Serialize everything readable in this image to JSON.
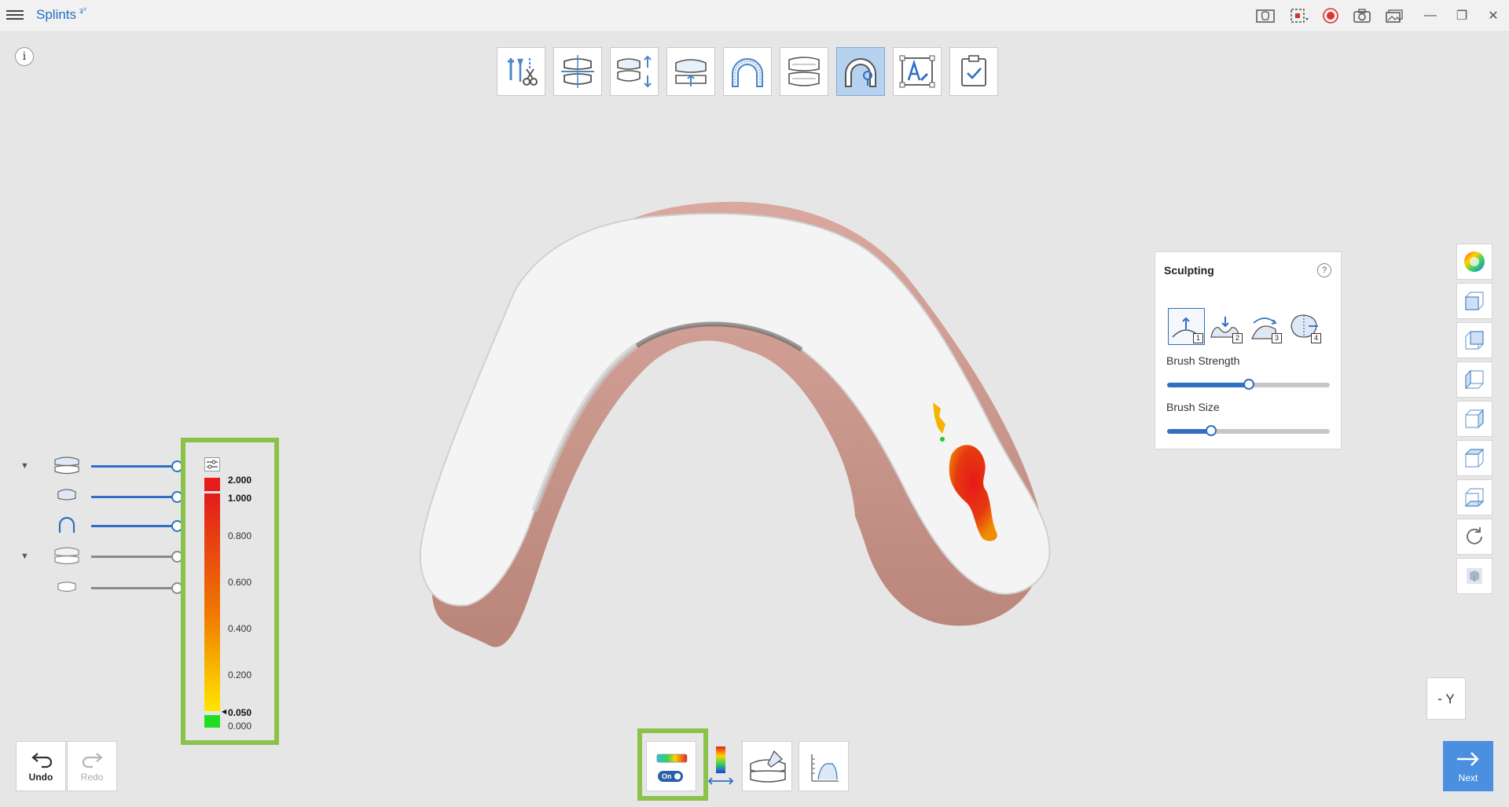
{
  "app": {
    "title": "Splints",
    "title_badge": "ⱻⱽ"
  },
  "window": {
    "minimize": "—",
    "maximize": "❐",
    "close": "✕"
  },
  "info_icon": "i",
  "workflow_steps": [
    {
      "name": "tooth-prep"
    },
    {
      "name": "bite-align"
    },
    {
      "name": "insertion-direction"
    },
    {
      "name": "occlusal-plane"
    },
    {
      "name": "design-arch"
    },
    {
      "name": "occlusion-check"
    },
    {
      "name": "sculpting",
      "active": true
    },
    {
      "name": "text-label"
    },
    {
      "name": "finish"
    }
  ],
  "layers": [
    {
      "name": "upper-jaw-with-splint",
      "expandable": true,
      "visible": true
    },
    {
      "name": "upper-splint",
      "expandable": false,
      "visible": true
    },
    {
      "name": "splint-shell",
      "expandable": false,
      "visible": true
    },
    {
      "name": "lower-jaw",
      "expandable": true,
      "visible": false
    },
    {
      "name": "lower-antagonist",
      "expandable": false,
      "visible": false
    }
  ],
  "deviation_legend": {
    "labels": [
      "2.000",
      "1.000",
      "0.800",
      "0.600",
      "0.400",
      "0.200",
      "0.050",
      "0.000"
    ],
    "bold_labels": [
      "2.000",
      "1.000",
      "0.050"
    ],
    "colors": {
      "top": "#e02424",
      "mid": "#f08c00",
      "low": "#ffe000",
      "zero": "#22dd22"
    }
  },
  "sculpting": {
    "title": "Sculpting",
    "help_icon": "?",
    "tools": [
      {
        "name": "add-brush",
        "number": "1",
        "active": true
      },
      {
        "name": "remove-brush",
        "number": "2"
      },
      {
        "name": "smooth-brush",
        "number": "3"
      },
      {
        "name": "morph-brush",
        "number": "4"
      }
    ],
    "brush_strength_label": "Brush Strength",
    "brush_strength": 0.5,
    "brush_size_label": "Brush Size",
    "brush_size": 0.27
  },
  "view_controls": [
    "color-wheel",
    "view-front",
    "view-back",
    "view-left",
    "view-right",
    "view-top",
    "view-bottom",
    "rotate-view",
    "texture-view"
  ],
  "axis_indicator": "- Y",
  "undo_label": "Undo",
  "redo_label": "Redo",
  "next_label": "Next",
  "bottom_tools": [
    {
      "name": "deviation-map",
      "toggle_label": "On"
    },
    {
      "name": "color-range"
    },
    {
      "name": "contact-check"
    },
    {
      "name": "measure-tool"
    }
  ],
  "colors": {
    "accent": "#2f6fc4",
    "highlight": "#8bc34a",
    "next": "#4b8fe0"
  }
}
